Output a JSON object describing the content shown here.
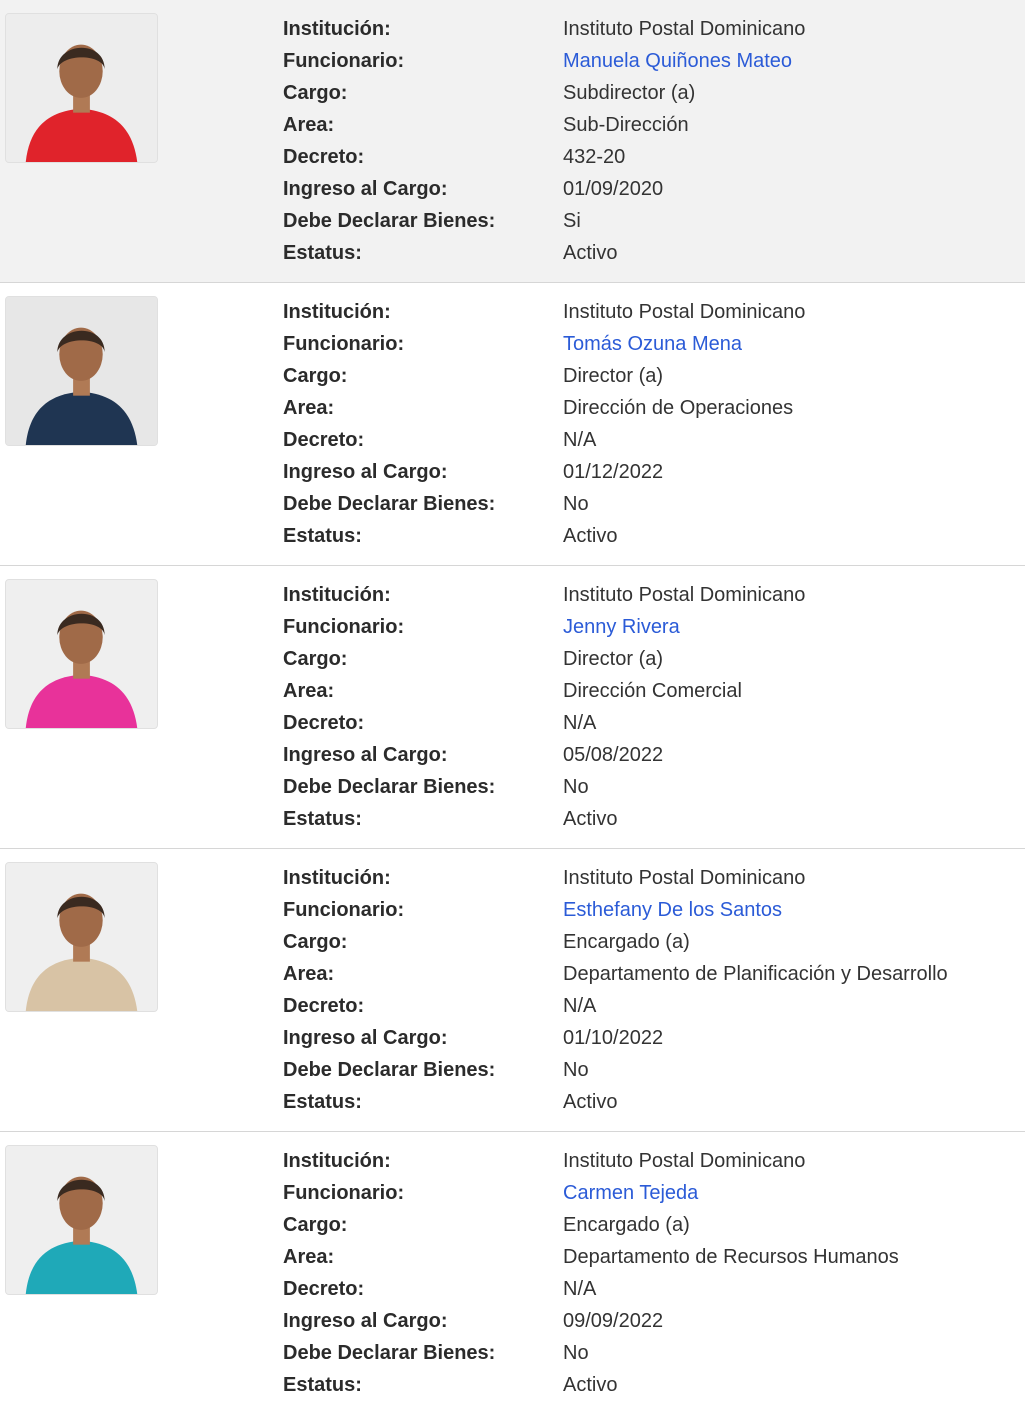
{
  "labels": {
    "institucion": "Institución:",
    "funcionario": "Funcionario:",
    "cargo": "Cargo:",
    "area": "Area:",
    "decreto": "Decreto:",
    "ingreso": "Ingreso al Cargo:",
    "declarar": "Debe Declarar Bienes:",
    "estatus": "Estatus:"
  },
  "colors": {
    "link": "#2b5bd7",
    "highlight_row": "#f2f2f2"
  },
  "officials": [
    {
      "institucion": "Instituto Postal Dominicano",
      "funcionario": "Manuela Quiñones Mateo",
      "cargo": "Subdirector (a)",
      "area": "Sub-Dirección",
      "decreto": "432-20",
      "ingreso": "01/09/2020",
      "declarar": "Si",
      "estatus": "Activo",
      "photo_outfit_color": "#e0232b",
      "photo_bg": "#ededed"
    },
    {
      "institucion": "Instituto Postal Dominicano",
      "funcionario": "Tomás Ozuna Mena",
      "cargo": "Director (a)",
      "area": "Dirección de Operaciones",
      "decreto": "N/A",
      "ingreso": "01/12/2022",
      "declarar": "No",
      "estatus": "Activo",
      "photo_outfit_color": "#1f3552",
      "photo_bg": "#e7e7e7"
    },
    {
      "institucion": "Instituto Postal Dominicano",
      "funcionario": "Jenny Rivera",
      "cargo": "Director (a)",
      "area": "Dirección Comercial",
      "decreto": "N/A",
      "ingreso": "05/08/2022",
      "declarar": "No",
      "estatus": "Activo",
      "photo_outfit_color": "#e8329a",
      "photo_bg": "#efefef"
    },
    {
      "institucion": "Instituto Postal Dominicano",
      "funcionario": "Esthefany De los Santos",
      "cargo": "Encargado (a)",
      "area": "Departamento de Planificación y Desarrollo",
      "decreto": "N/A",
      "ingreso": "01/10/2022",
      "declarar": "No",
      "estatus": "Activo",
      "photo_outfit_color": "#d8c3a5",
      "photo_bg": "#efefef"
    },
    {
      "institucion": "Instituto Postal Dominicano",
      "funcionario": "Carmen Tejeda",
      "cargo": "Encargado (a)",
      "area": "Departamento de Recursos Humanos",
      "decreto": "N/A",
      "ingreso": "09/09/2022",
      "declarar": "No",
      "estatus": "Activo",
      "photo_outfit_color": "#1fa9b8",
      "photo_bg": "#efefef"
    }
  ]
}
